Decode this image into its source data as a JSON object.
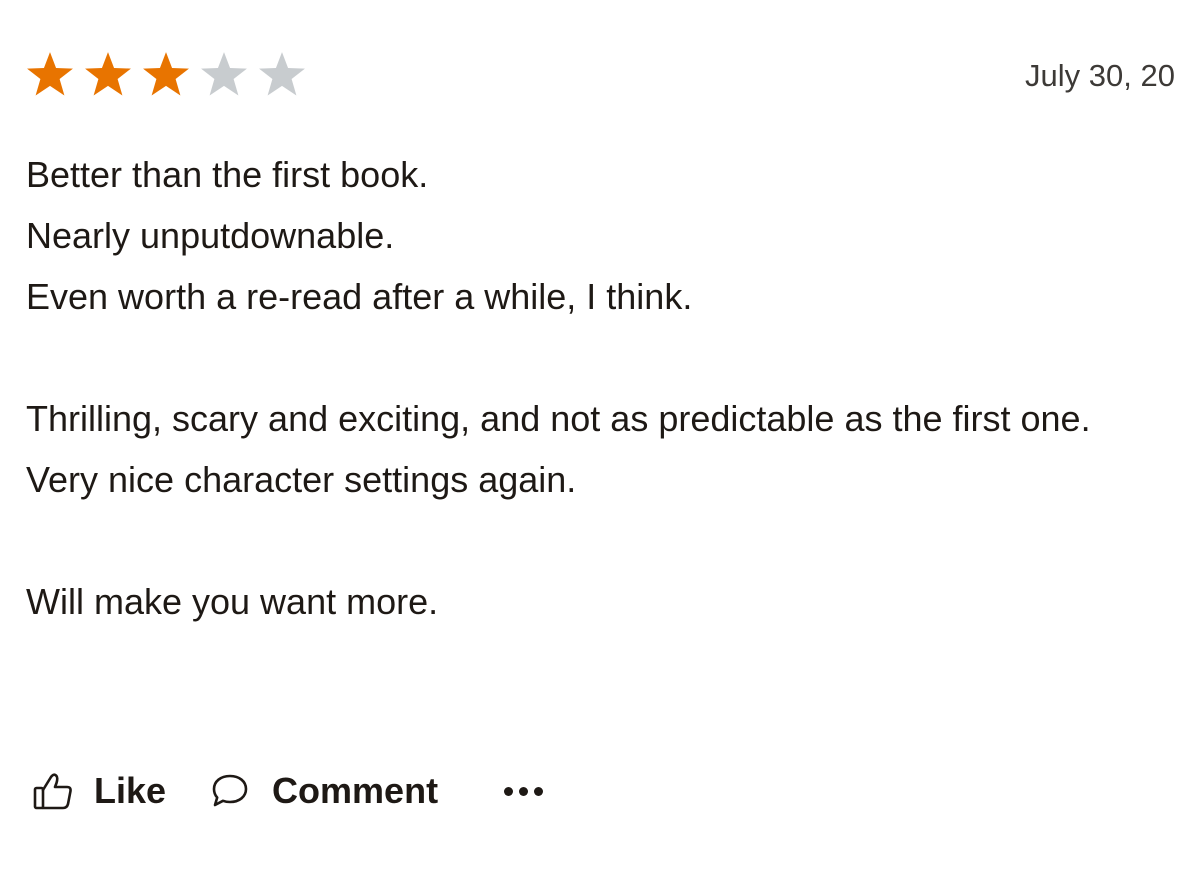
{
  "rating": {
    "value": 3,
    "max": 5,
    "filled_color": "#e87400",
    "empty_color": "#c8cccf"
  },
  "date": "July 30, 20",
  "review": {
    "paragraphs": [
      [
        "Better than the first book.",
        "Nearly unputdownable.",
        "Even worth a re-read after a while, I think."
      ],
      [
        "Thrilling, scary and exciting, and not as predictable as the first one.",
        "Very nice character settings again."
      ],
      [
        "Will make you want more."
      ]
    ]
  },
  "actions": {
    "like_label": "Like",
    "like_icon": "thumbs-up-icon",
    "comment_label": "Comment",
    "comment_icon": "speech-bubble-icon",
    "more_icon": "more-options-icon"
  }
}
